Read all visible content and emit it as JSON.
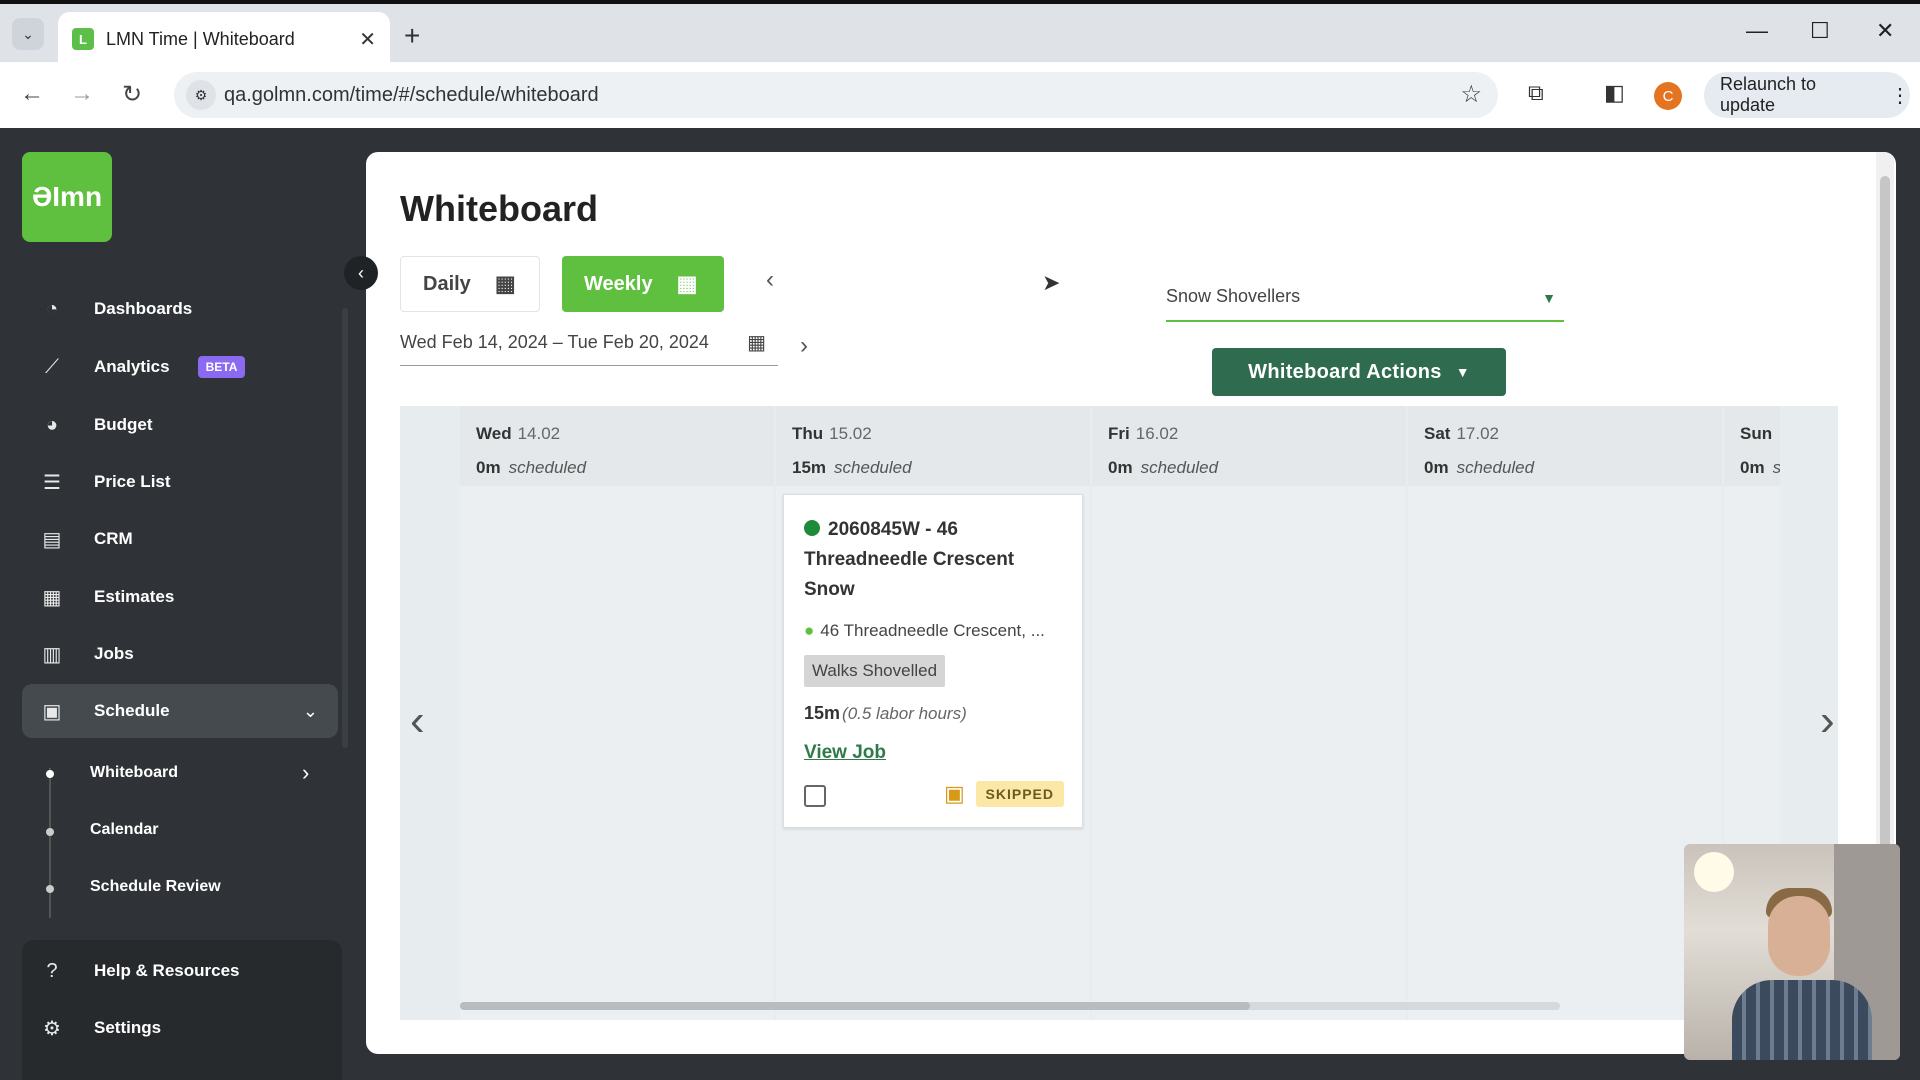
{
  "browser": {
    "tab_title": "LMN Time | Whiteboard",
    "url": "qa.golmn.com/time/#/schedule/whiteboard",
    "relaunch_label": "Relaunch to update",
    "profile_initial": "C"
  },
  "app": {
    "logo_text": "ƏImn",
    "accent_color": "#5fbf3f",
    "dark_green": "#2f6b4f"
  },
  "sidebar": {
    "items": [
      {
        "label": "Dashboards",
        "icon": "dashboard-icon"
      },
      {
        "label": "Analytics",
        "icon": "analytics-icon",
        "badge": "BETA"
      },
      {
        "label": "Budget",
        "icon": "budget-icon"
      },
      {
        "label": "Price List",
        "icon": "list-icon"
      },
      {
        "label": "CRM",
        "icon": "crm-icon"
      },
      {
        "label": "Estimates",
        "icon": "estimates-icon"
      },
      {
        "label": "Jobs",
        "icon": "jobs-icon"
      },
      {
        "label": "Schedule",
        "icon": "schedule-icon"
      }
    ],
    "schedule_sub": [
      "Whiteboard",
      "Calendar",
      "Schedule Review"
    ],
    "bottom": [
      {
        "label": "Help & Resources",
        "icon": "help-icon"
      },
      {
        "label": "Settings",
        "icon": "settings-icon"
      }
    ]
  },
  "main": {
    "title": "Whiteboard",
    "daily_label": "Daily",
    "weekly_label": "Weekly",
    "date_range": "Wed Feb 14, 2024 – Tue Feb 20, 2024",
    "crew": "Snow Shovellers",
    "actions_label": "Whiteboard Actions"
  },
  "days": [
    {
      "name": "Wed",
      "date": "14.02",
      "minutes": "0m",
      "scheduled": "scheduled"
    },
    {
      "name": "Thu",
      "date": "15.02",
      "minutes": "15m",
      "scheduled": "scheduled"
    },
    {
      "name": "Fri",
      "date": "16.02",
      "minutes": "0m",
      "scheduled": "scheduled"
    },
    {
      "name": "Sat",
      "date": "17.02",
      "minutes": "0m",
      "scheduled": "scheduled"
    },
    {
      "name": "Sun",
      "date": "",
      "minutes": "0m",
      "scheduled": "s"
    }
  ],
  "job": {
    "title": "2060845W - 46 Threadneedle Crescent Snow",
    "address": "46 Threadneedle Crescent, ...",
    "tag": "Walks Shovelled",
    "duration": "15m",
    "labor_hours": "(0.5 labor hours)",
    "view_label": "View Job",
    "status": "SKIPPED",
    "status_color": "#1f8a3a"
  }
}
